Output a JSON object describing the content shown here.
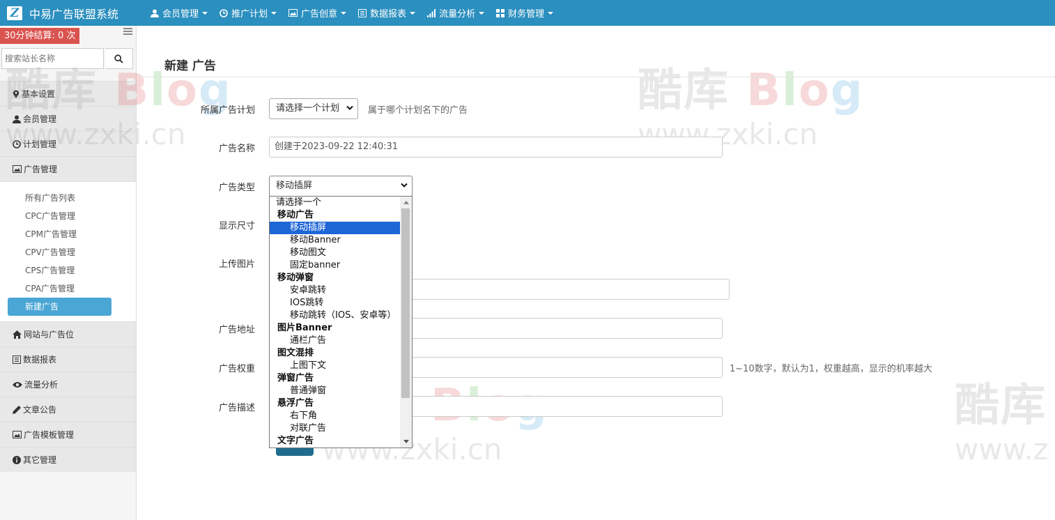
{
  "brand": {
    "logo_letter": "Z",
    "name": "中易广告联盟系统"
  },
  "nav": [
    {
      "label": "会员管理",
      "icon": "user-icon"
    },
    {
      "label": "推广计划",
      "icon": "clock-icon"
    },
    {
      "label": "广告创意",
      "icon": "picture-icon"
    },
    {
      "label": "数据报表",
      "icon": "list-icon"
    },
    {
      "label": "流量分析",
      "icon": "signal-icon"
    },
    {
      "label": "财务管理",
      "icon": "grid-icon"
    }
  ],
  "sidebar": {
    "settle_badge": "30分钟结算: 0 次",
    "search_placeholder": "搜索站长名称",
    "menu_top": [
      {
        "label": "基本设置",
        "icon": "map-marker-icon"
      },
      {
        "label": "会员管理",
        "icon": "user-icon"
      },
      {
        "label": "计划管理",
        "icon": "clock-icon"
      },
      {
        "label": "广告管理",
        "icon": "picture-icon"
      }
    ],
    "sub_items": [
      {
        "label": "所有广告列表"
      },
      {
        "label": "CPC广告管理"
      },
      {
        "label": "CPM广告管理"
      },
      {
        "label": "CPV广告管理"
      },
      {
        "label": "CPS广告管理"
      },
      {
        "label": "CPA广告管理"
      },
      {
        "label": "新建广告",
        "active": true
      }
    ],
    "menu_bottom": [
      {
        "label": "网站与广告位",
        "icon": "home-icon"
      },
      {
        "label": "数据报表",
        "icon": "list-icon"
      },
      {
        "label": "流量分析",
        "icon": "eye-icon"
      },
      {
        "label": "文章公告",
        "icon": "pencil-icon"
      },
      {
        "label": "广告模板管理",
        "icon": "picture-icon"
      },
      {
        "label": "其它管理",
        "icon": "info-icon"
      }
    ]
  },
  "main": {
    "title": "新建 广告",
    "form": {
      "plan_label": "所属广告计划",
      "plan_selected": "请选择一个计划",
      "plan_help": "属于哪个计划名下的广告",
      "name_label": "广告名称",
      "name_value": "创建于2023-09-22 12:40:31",
      "type_label": "广告类型",
      "type_selected": "移动插屏",
      "size_label": "显示尺寸",
      "upload_label": "上传图片",
      "url_label": "广告地址",
      "weight_label": "广告权重",
      "weight_help": "1~10数字，默认为1，权重越高，显示的机率越大",
      "desc_label": "广告描述"
    },
    "type_options": [
      {
        "kind": "top",
        "label": "请选择一个"
      },
      {
        "kind": "group",
        "label": "移动广告"
      },
      {
        "kind": "opt",
        "label": "移动插屏",
        "selected": true
      },
      {
        "kind": "opt",
        "label": "移动Banner"
      },
      {
        "kind": "opt",
        "label": "移动图文"
      },
      {
        "kind": "opt",
        "label": "固定banner"
      },
      {
        "kind": "group",
        "label": "移动弹窗"
      },
      {
        "kind": "opt",
        "label": "安卓跳转"
      },
      {
        "kind": "opt",
        "label": "IOS跳转"
      },
      {
        "kind": "opt",
        "label": "移动跳转（IOS、安卓等）"
      },
      {
        "kind": "group",
        "label": "图片Banner"
      },
      {
        "kind": "opt",
        "label": "通栏广告"
      },
      {
        "kind": "group",
        "label": "图文混排"
      },
      {
        "kind": "opt",
        "label": "上图下文"
      },
      {
        "kind": "group",
        "label": "弹窗广告"
      },
      {
        "kind": "opt",
        "label": "普通弹窗"
      },
      {
        "kind": "group",
        "label": "悬浮广告"
      },
      {
        "kind": "opt",
        "label": "右下角"
      },
      {
        "kind": "opt",
        "label": "对联广告"
      },
      {
        "kind": "group",
        "label": "文字广告"
      }
    ]
  },
  "watermarks": [
    {
      "prefix": "酷库",
      "b": "B",
      "l": "l",
      "o": "o",
      "g": "g",
      "url": "www.zxki.cn"
    }
  ],
  "colors": {
    "navbar": "#2b8fbf",
    "badge": "#d9534f",
    "active_sub": "#4aa6d4",
    "selected_option": "#1e66d6"
  }
}
